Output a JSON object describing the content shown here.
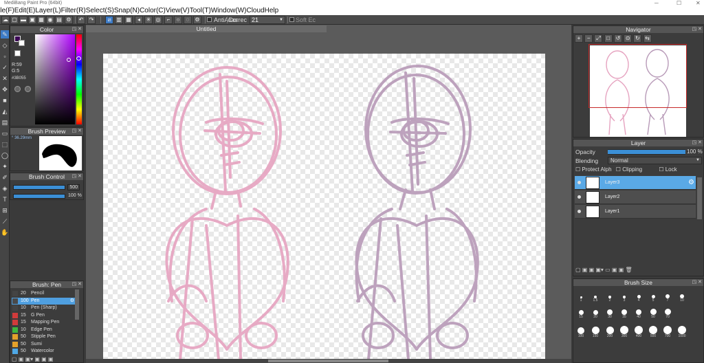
{
  "app": {
    "title": "MediBang Paint Pro (64bit)"
  },
  "menu": [
    "ile(F)",
    "Edit(E)",
    "Layer(L)",
    "Filter(R)",
    "Select(S)",
    "Snap(N)",
    "Color(C)",
    "View(V)",
    "Tool(T)",
    "Window(W)",
    "Cloud",
    "Help"
  ],
  "toolbar": {
    "antialias_label": "AntiAlias",
    "correction_label": "Correc",
    "correction_value": "21",
    "soft_label": "Soft Ec"
  },
  "document": {
    "tab_title": "Untitled"
  },
  "color_panel": {
    "title": "Color",
    "r_label": "R:59",
    "g_label": "G:5",
    "hex_label": "#3B055",
    "primary_color": "#3b0555",
    "hue_position": 0.27,
    "sv_position": {
      "s": 0.85,
      "v": 0.72
    }
  },
  "brush_preview": {
    "title": "Brush Preview",
    "size_label": "36.29mm"
  },
  "brush_control": {
    "title": "Brush Control",
    "size_value": "500",
    "opacity_value": "100 %",
    "size_fraction": 1.0,
    "opacity_fraction": 1.0
  },
  "brush_list": {
    "title": "Brush: Pen",
    "items": [
      {
        "size": "20",
        "name": "Pencil",
        "color": "#444444"
      },
      {
        "size": "100",
        "name": "Pen",
        "color": "#4a4a4a",
        "selected": true
      },
      {
        "size": "10",
        "name": "Pen (Sharp)",
        "color": "#444444"
      },
      {
        "size": "15",
        "name": "G Pen",
        "color": "#d23b3b"
      },
      {
        "size": "15",
        "name": "Mapping Pen",
        "color": "#d23b3b"
      },
      {
        "size": "10",
        "name": "Edge Pen",
        "color": "#3fb53f"
      },
      {
        "size": "50",
        "name": "Stipple Pen",
        "color": "#e3a12b"
      },
      {
        "size": "50",
        "name": "Sumi",
        "color": "#e3a12b"
      },
      {
        "size": "50",
        "name": "Watercolor",
        "color": "#4fa8e6"
      }
    ]
  },
  "navigator": {
    "title": "Navigator"
  },
  "layer_panel": {
    "title": "Layer",
    "opacity_label": "Opacity",
    "opacity_value": "100 %",
    "opacity_fraction": 1.0,
    "blending_label": "Blending",
    "blending_value": "Normal",
    "protect_alpha": "Protect Alph",
    "clipping": "Clipping",
    "lock": "Lock",
    "layers": [
      {
        "name": "Layer3",
        "selected": true
      },
      {
        "name": "Layer2",
        "selected": false
      },
      {
        "name": "Layer1",
        "selected": false
      }
    ]
  },
  "brush_size_panel": {
    "title": "Brush Size",
    "sizes": [
      "1",
      "1.5",
      "2",
      "3",
      "4",
      "5",
      "7",
      "10",
      "15",
      "20",
      "30",
      "35",
      "40",
      "50",
      "70",
      "100",
      "150",
      "200",
      "300",
      "400",
      "500",
      "700",
      "1000"
    ]
  },
  "colors": {
    "accent": "#3d7bc6",
    "sketch_left": "#e6a3c0",
    "sketch_right": "#b89ab8"
  }
}
